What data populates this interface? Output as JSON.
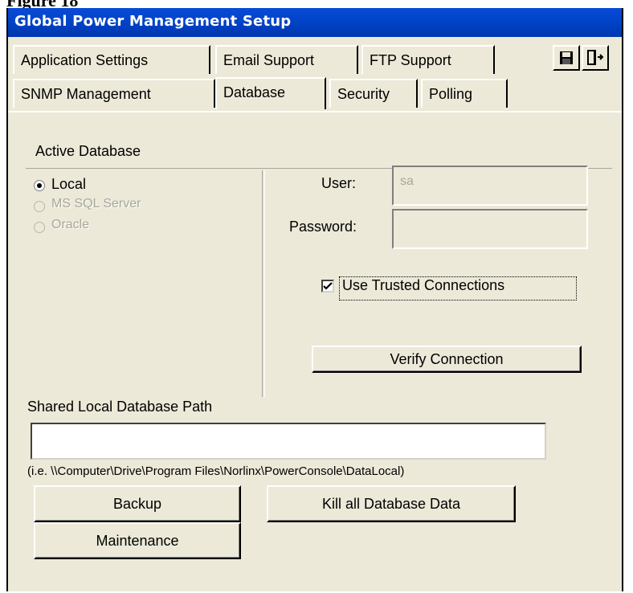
{
  "figure_label": "Figure 18",
  "window": {
    "title": "Global Power Management Setup"
  },
  "tabs_row1": [
    "Application Settings",
    "Email Support",
    "FTP Support"
  ],
  "tabs_row2": [
    "SNMP Management",
    "Database",
    "Security",
    "Polling"
  ],
  "active_tab": "Database",
  "toolbar": {
    "save_icon": "floppy-disk-icon",
    "exit_icon": "exit-door-icon"
  },
  "database": {
    "section_title": "Active Database",
    "options": [
      {
        "label": "Local",
        "selected": true,
        "enabled": true
      },
      {
        "label": "MS SQL Server",
        "selected": false,
        "enabled": false
      },
      {
        "label": "Oracle",
        "selected": false,
        "enabled": false
      }
    ],
    "user_label": "User:",
    "user_value": "sa",
    "password_label": "Password:",
    "password_value": "",
    "trusted_label": "Use Trusted Connections",
    "trusted_checked": true,
    "verify_button": "Verify Connection",
    "shared_path_label": "Shared Local Database Path",
    "shared_path_value": "",
    "shared_path_hint": "(i.e. \\\\Computer\\Drive\\Program Files\\Norlinx\\PowerConsole\\DataLocal)"
  },
  "buttons": {
    "backup": "Backup",
    "kill": "Kill all Database Data",
    "maintenance": "Maintenance"
  },
  "colors": {
    "titlebar": "#0044c8",
    "face": "#ece9d8",
    "disabled_text": "#a7a69a"
  }
}
